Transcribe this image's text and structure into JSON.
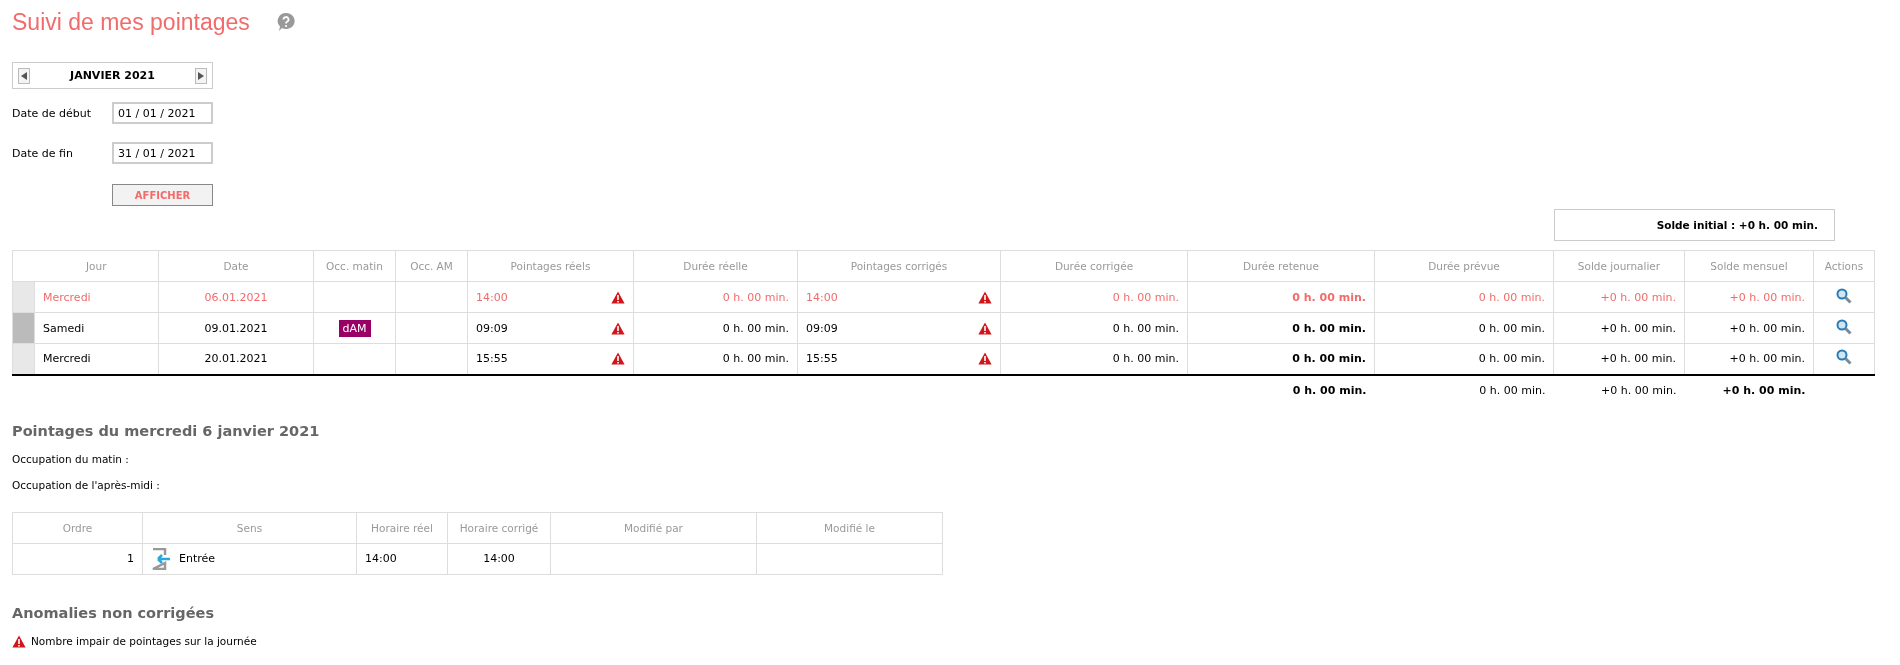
{
  "title": "Suivi de mes pointages",
  "period": {
    "label": "JANVIER 2021"
  },
  "filters": [
    {
      "label": "Date de début",
      "value": "01 / 01 / 2021"
    },
    {
      "label": "Date de fin",
      "value": "31 / 01 / 2021"
    }
  ],
  "show_button": "AFFICHER",
  "initial_balance": "Solde initial : +0 h. 00 min.",
  "table": {
    "columns": [
      "Jour",
      "Date",
      "Occ. matin",
      "Occ. AM",
      "Pointages réels",
      "Durée réelle",
      "Pointages corrigés",
      "Durée corrigée",
      "Durée retenue",
      "Durée prévue",
      "Solde journalier",
      "Solde mensuel",
      "Actions"
    ],
    "rows": [
      {
        "selected": true,
        "marked": false,
        "day": "Mercredi",
        "date": "06.01.2021",
        "occ_morning": "",
        "occ_afternoon": "",
        "real": "14:00",
        "real_warning": true,
        "real_duration": "0 h. 00 min.",
        "corrected": "14:00",
        "corrected_warning": true,
        "corrected_duration": "0 h. 00 min.",
        "kept_duration": "0 h. 00 min.",
        "planned_duration": "0 h. 00 min.",
        "daily_balance": "+0 h. 00 min.",
        "monthly_balance": "+0 h. 00 min."
      },
      {
        "selected": false,
        "marked": true,
        "day": "Samedi",
        "date": "09.01.2021",
        "occ_morning": "dAM",
        "occ_afternoon": "",
        "real": "09:09",
        "real_warning": true,
        "real_duration": "0 h. 00 min.",
        "corrected": "09:09",
        "corrected_warning": true,
        "corrected_duration": "0 h. 00 min.",
        "kept_duration": "0 h. 00 min.",
        "planned_duration": "0 h. 00 min.",
        "daily_balance": "+0 h. 00 min.",
        "monthly_balance": "+0 h. 00 min."
      },
      {
        "selected": false,
        "marked": false,
        "day": "Mercredi",
        "date": "20.01.2021",
        "occ_morning": "",
        "occ_afternoon": "",
        "real": "15:55",
        "real_warning": true,
        "real_duration": "0 h. 00 min.",
        "corrected": "15:55",
        "corrected_warning": true,
        "corrected_duration": "0 h. 00 min.",
        "kept_duration": "0 h. 00 min.",
        "planned_duration": "0 h. 00 min.",
        "daily_balance": "+0 h. 00 min.",
        "monthly_balance": "+0 h. 00 min."
      }
    ],
    "totals": {
      "kept_duration": "0 h. 00 min.",
      "planned_duration": "0 h. 00 min.",
      "daily_balance": "+0 h. 00 min.",
      "monthly_balance": "+0 h. 00 min."
    }
  },
  "detail": {
    "heading": "Pointages du mercredi 6 janvier 2021",
    "lines": [
      "Occupation du matin :",
      "Occupation de l'après-midi :"
    ],
    "columns": [
      "Ordre",
      "Sens",
      "Horaire réel",
      "Horaire corrigé",
      "Modifié par",
      "Modifié le"
    ],
    "rows": [
      {
        "order": "1",
        "direction": "Entrée",
        "kind": "in",
        "real": "14:00",
        "corrected": "14:00"
      }
    ]
  },
  "anomalies": {
    "heading": "Anomalies non corrigées",
    "items": [
      "Nombre impair de pointages sur la journée"
    ]
  }
}
